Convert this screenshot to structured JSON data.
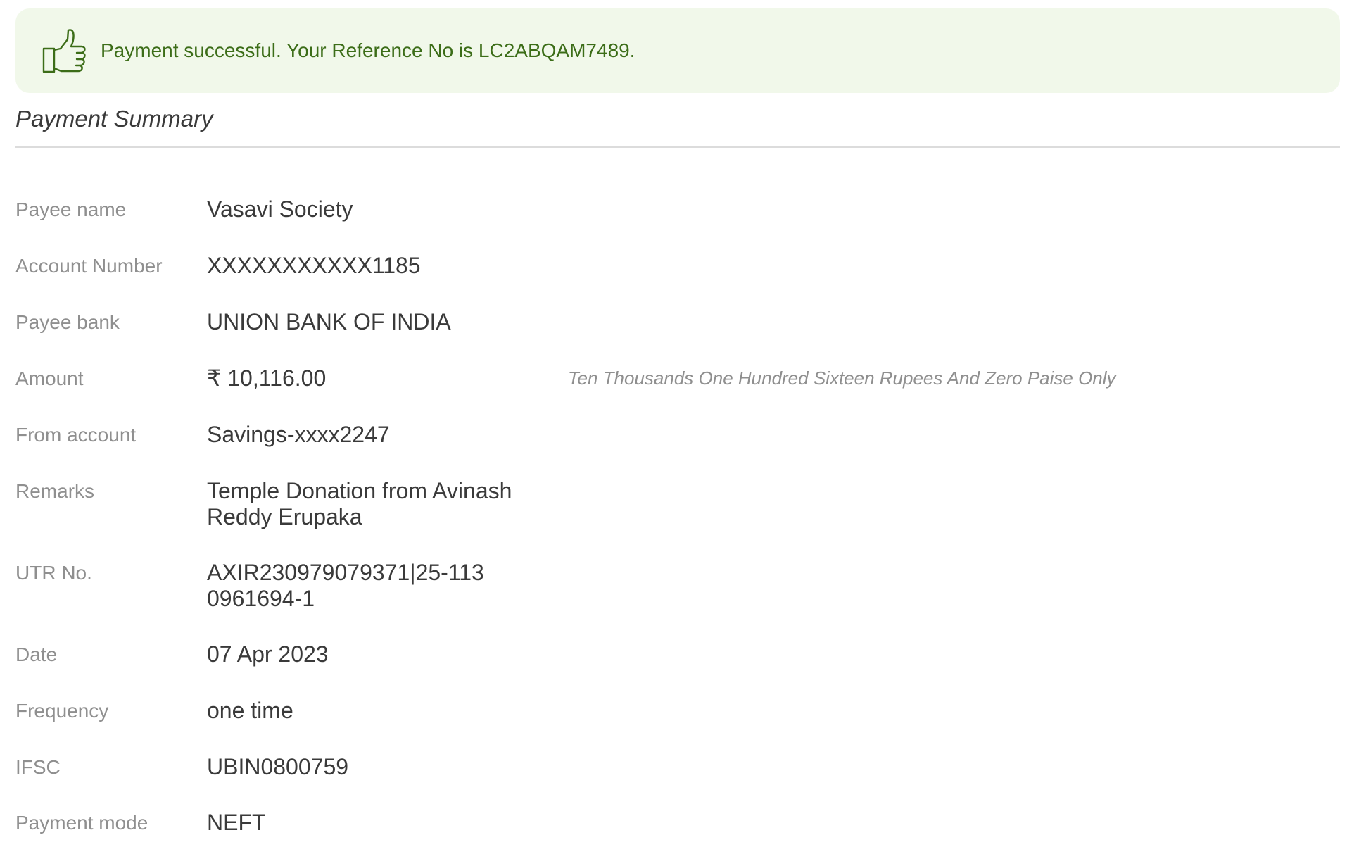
{
  "banner": {
    "icon": "thumbs-up-icon",
    "message": "Payment successful. Your Reference No is LC2ABQAM7489.",
    "color": "#3c6d18",
    "background": "#f1f8ea"
  },
  "summary": {
    "title": "Payment Summary"
  },
  "fields": {
    "payee_name": {
      "label": "Payee name",
      "value": "Vasavi Society"
    },
    "account_number": {
      "label": "Account Number",
      "value": "XXXXXXXXXXX1185"
    },
    "payee_bank": {
      "label": "Payee bank",
      "value": "UNION BANK OF INDIA"
    },
    "amount": {
      "label": "Amount",
      "value": "₹ 10,116.00",
      "words": "Ten Thousands One Hundred Sixteen Rupees And Zero Paise Only"
    },
    "from_account": {
      "label": "From account",
      "value": "Savings-xxxx2247"
    },
    "remarks": {
      "label": "Remarks",
      "value": "Temple Donation from Avinash Reddy Erupaka"
    },
    "utr_no": {
      "label": "UTR No.",
      "value": "AXIR230979079371|25-1130961694-1"
    },
    "date": {
      "label": "Date",
      "value": "07 Apr 2023"
    },
    "frequency": {
      "label": "Frequency",
      "value": "one time"
    },
    "ifsc": {
      "label": "IFSC",
      "value": "UBIN0800759"
    },
    "payment_mode": {
      "label": "Payment mode",
      "value": "NEFT"
    }
  }
}
